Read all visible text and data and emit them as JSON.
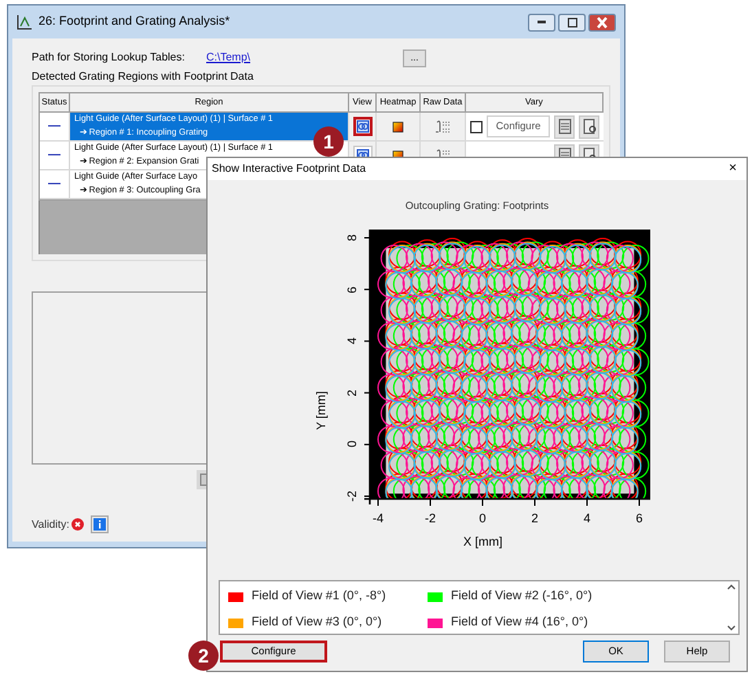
{
  "main_window": {
    "title": "26: Footprint and Grating Analysis*",
    "path_label": "Path for Storing Lookup Tables:",
    "path_value": "C:\\Temp\\",
    "browse_button": "...",
    "group_title": "Detected Grating Regions with Footprint Data",
    "columns": [
      "Status",
      "Region",
      "View",
      "Heatmap",
      "Raw Data",
      "Vary"
    ],
    "rows": [
      {
        "status": "—",
        "line1": "Light Guide (After Surface Layout) (1) | Surface # 1",
        "line2": "➔ Region # 1: Incoupling Grating",
        "selected": true,
        "view_highlighted": true,
        "vary_checked": false,
        "configure": "Configure"
      },
      {
        "status": "—",
        "line1": "Light Guide (After Surface Layout) (1) | Surface # 1",
        "line2": "➔ Region # 2: Expansion Grati",
        "selected": false,
        "view_highlighted": false
      },
      {
        "status": "—",
        "line1": "Light Guide (After Surface Layo",
        "line2": "➔ Region # 3: Outcoupling Gra",
        "selected": false
      }
    ],
    "validity_label": "Validity:"
  },
  "dialog": {
    "title": "Show Interactive Footprint Data",
    "close": "×",
    "plot": {
      "title": "Outcoupling Grating: Footprints",
      "xlabel": "X [mm]",
      "ylabel": "Y [mm]",
      "xticks": [
        "-4",
        "-2",
        "0",
        "2",
        "4",
        "6"
      ],
      "yticks": [
        "8",
        "6",
        "4",
        "2",
        "0",
        "-2"
      ]
    },
    "legend": [
      {
        "label": "Field of View #1 (0°, -8°)",
        "color": "#ff0000"
      },
      {
        "label": "Field of View #2 (-16°, 0°)",
        "color": "#00ff00"
      },
      {
        "label": "Field of View #3 (0°, 0°)",
        "color": "#ffa500"
      },
      {
        "label": "Field of View #4 (16°, 0°)",
        "color": "#ff1493"
      }
    ],
    "buttons": [
      {
        "kind": "configure",
        "label": "Configure",
        "highlighted": true
      },
      {
        "kind": "ok",
        "label": "OK",
        "highlighted": false
      },
      {
        "kind": "help",
        "label": "Help",
        "highlighted": false
      }
    ]
  },
  "callouts": [
    "1",
    "2"
  ]
}
